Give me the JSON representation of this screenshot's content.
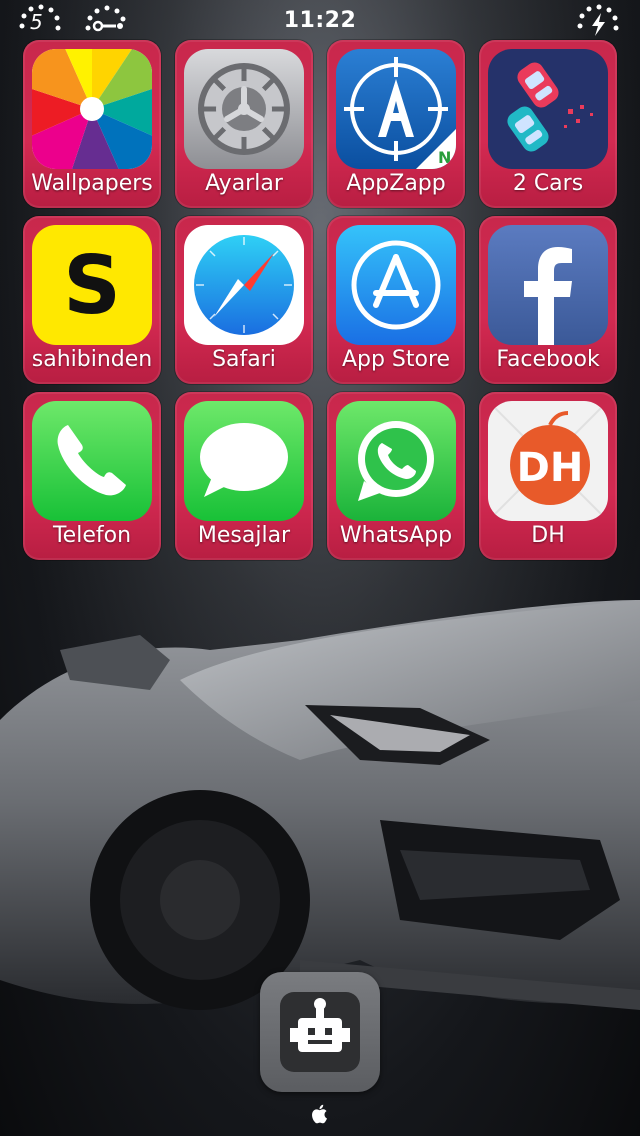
{
  "status_bar": {
    "left_badge_number": "5",
    "time": "11:22",
    "icons": [
      "signal-dots-icon",
      "wifi-dots-icon",
      "battery-charging-icon"
    ]
  },
  "apps": [
    {
      "label": "Wallpapers",
      "icon": "wallpapers-icon"
    },
    {
      "label": "Ayarlar",
      "icon": "settings-gear-icon"
    },
    {
      "label": "AppZapp",
      "icon": "appzapp-icon"
    },
    {
      "label": "2 Cars",
      "icon": "two-cars-icon"
    },
    {
      "label": "sahibinden",
      "icon": "sahibinden-icon"
    },
    {
      "label": "Safari",
      "icon": "safari-compass-icon"
    },
    {
      "label": "App Store",
      "icon": "app-store-icon"
    },
    {
      "label": "Facebook",
      "icon": "facebook-icon"
    },
    {
      "label": "Telefon",
      "icon": "phone-icon"
    },
    {
      "label": "Mesajlar",
      "icon": "messages-icon"
    },
    {
      "label": "WhatsApp",
      "icon": "whatsapp-icon"
    },
    {
      "label": "DH",
      "icon": "dh-icon"
    }
  ],
  "dock": {
    "app_icon": "robot-app-icon",
    "logo": "apple-logo-icon"
  },
  "colors": {
    "tile_background": "#d42a52",
    "wallpaper_dark": "#15171b"
  }
}
